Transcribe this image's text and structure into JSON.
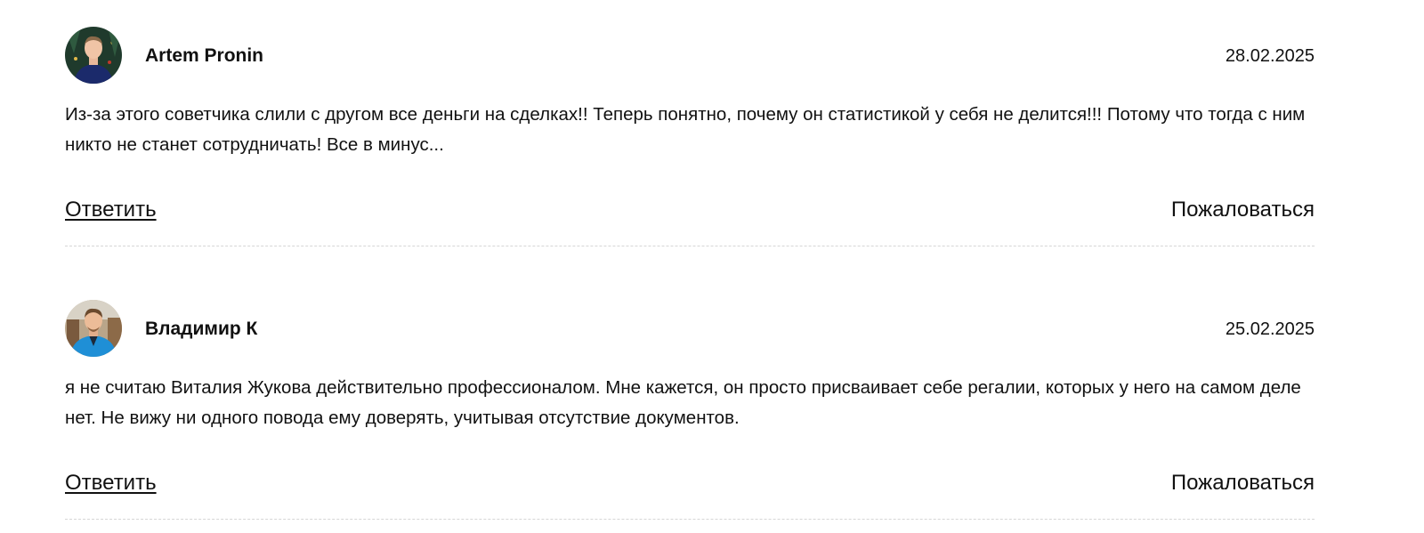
{
  "comments": [
    {
      "author": "Artem Pronin",
      "date": "28.02.2025",
      "text": "Из-за этого советчика слили с другом все деньги на сделках!! Теперь понятно, почему он статистикой у себя не делится!!! Потому что тогда с ним никто не станет сотрудничать! Все в минус...",
      "avatar_icon": "user-avatar-photo",
      "reply_label": "Ответить",
      "complain_label": "Пожаловаться"
    },
    {
      "author": "Владимир К",
      "date": "25.02.2025",
      "text": "я не считаю Виталия Жукова действительно профессионалом. Мне кажется, он просто присваивает себе регалии, которых у него на самом деле нет. Не вижу ни одного повода ему доверять, учитывая отсутствие документов.",
      "avatar_icon": "user-avatar-photo",
      "reply_label": "Ответить",
      "complain_label": "Пожаловаться"
    }
  ],
  "colors": {
    "text": "#111111",
    "divider": "#d6d6d6",
    "background": "#ffffff"
  }
}
